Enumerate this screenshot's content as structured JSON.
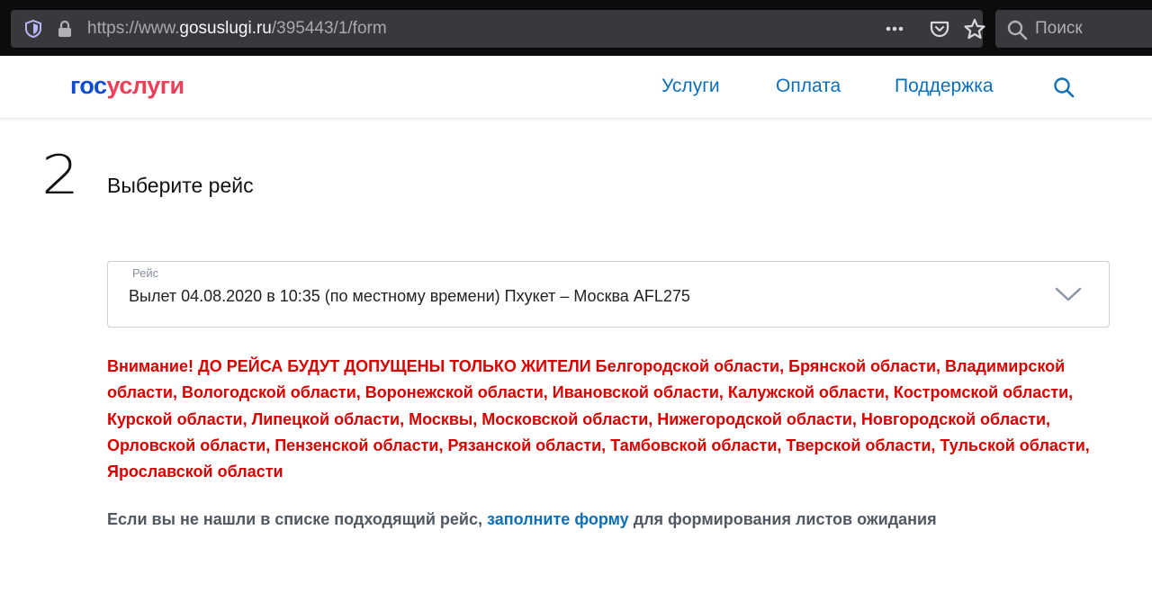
{
  "browser": {
    "url_prefix": "https://www.",
    "url_host": "gosuslugi.ru",
    "url_path": "/395443/1/form",
    "search_placeholder": "Поиск"
  },
  "header": {
    "logo_gos": "гос",
    "logo_uslugi": "услуги",
    "nav": [
      "Услуги",
      "Оплата",
      "Поддержка"
    ],
    "colors": {
      "logo_blue": "#0d4cd3",
      "logo_red": "#ee3f58",
      "link": "#0d6fb8"
    }
  },
  "step": {
    "number": "2",
    "title": "Выберите рейс"
  },
  "flight_select": {
    "label": "Рейс",
    "value": "Вылет 04.08.2020 в 10:35 (по местному времени) Пхукет – Москва AFL275"
  },
  "warning": {
    "text": "Внимание! ДО РЕЙСА БУДУТ ДОПУЩЕНЫ ТОЛЬКО ЖИТЕЛИ Белгородской области, Брянской области, Владимирской области, Вологодской области, Воронежской области, Ивановской области, Калужской области, Костромской области, Курской области, Липецкой области, Москвы, Московской области, Нижегородской области, Новгородской области, Орловской области, Пензенской области, Рязанской области, Тамбовской области, Тверской области, Тульской области, Ярославской области",
    "color": "#d90000"
  },
  "wait_note": {
    "before": "Если вы не нашли в списке подходящий рейс, ",
    "link": "заполните форму",
    "after": " для формирования листов ожидания"
  }
}
